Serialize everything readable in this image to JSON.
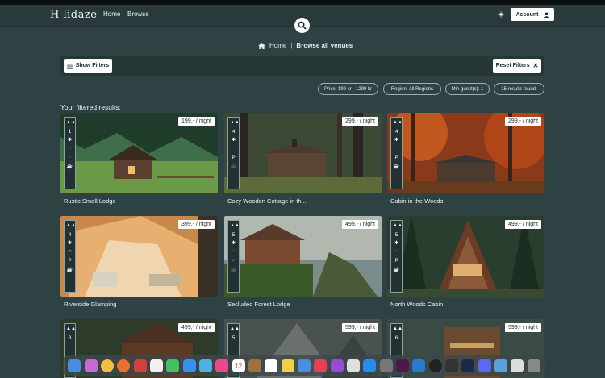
{
  "brand": {
    "logo_text": "H  lidaze"
  },
  "nav": {
    "home": "Home",
    "browse": "Browse",
    "account": "Account"
  },
  "breadcrumb": {
    "home": "Home",
    "separator": "|",
    "current": "Browse all venues"
  },
  "filters": {
    "show_label": "Show Filters",
    "reset_label": "Reset Filters",
    "chips": [
      "Price: 199 kr - 1299 kr",
      "Region: All Regions",
      "Min guest(s): 1",
      "15 results found."
    ]
  },
  "results_label": "Your filtered results:",
  "venues": [
    {
      "name": "Rustic Small Lodge",
      "price": "199,- / night",
      "guests": "1"
    },
    {
      "name": "Cozy Wooden Cottage in th...",
      "price": "299,- / night",
      "guests": "4"
    },
    {
      "name": "Cabin in the Woods",
      "price": "299,- / night",
      "guests": "4"
    },
    {
      "name": "Riverside Glamping",
      "price": "399,- / night",
      "guests": "4"
    },
    {
      "name": "Secluded Forest Lodge",
      "price": "499,- / night",
      "guests": "5"
    },
    {
      "name": "North Woods Cabin",
      "price": "499,- / night",
      "guests": "5"
    },
    {
      "name": "",
      "price": "499,- / night",
      "guests": "8"
    },
    {
      "name": "",
      "price": "599,- / night",
      "guests": "5"
    },
    {
      "name": "",
      "price": "599,- / night",
      "guests": "6"
    }
  ],
  "dock": {
    "calendar_day": "12"
  },
  "colors": {
    "background": "#2e4143",
    "navbar": "#2a3a3c",
    "accent": "#ffffff"
  }
}
